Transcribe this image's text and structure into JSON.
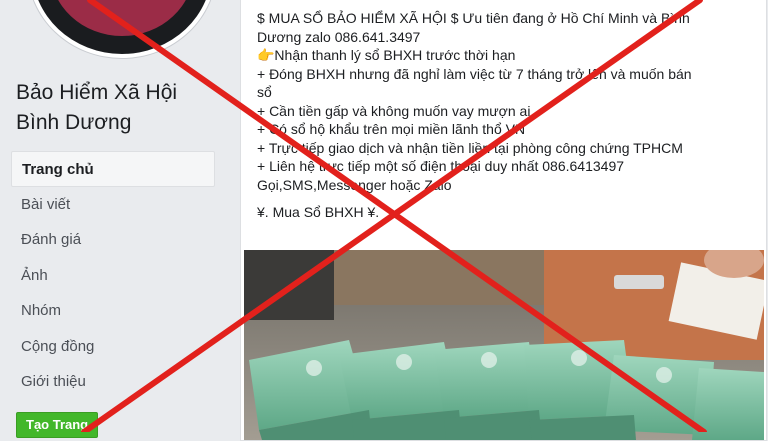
{
  "page": {
    "name_line1": "Bảo Hiểm Xã Hội",
    "name_line2": "Bình Dương"
  },
  "sidebar": {
    "items": [
      {
        "label": "Trang chủ",
        "active": true
      },
      {
        "label": "Bài viết"
      },
      {
        "label": "Đánh giá"
      },
      {
        "label": "Ảnh"
      },
      {
        "label": "Nhóm"
      },
      {
        "label": "Cộng đồng"
      },
      {
        "label": "Giới thiệu"
      }
    ],
    "create_page_label": "Tạo Trang"
  },
  "post": {
    "lines": [
      "$ MUA SỔ BẢO HIỂM XÃ HỘI $ Ưu tiên đang ở Hồ Chí Minh và Bình",
      "Dương zalo 086.641.3497",
      "👉Nhận thanh lý sổ BHXH trước thời hạn",
      "+ Đóng BHXH nhưng đã nghỉ làm việc từ 7 tháng trở lên và muốn bán",
      "sổ",
      "+ Cần tiền gấp và không muốn vay mượn ai",
      "+ Có sổ hộ khẩu trên mọi miền lãnh thổ VN",
      "+ Trực tiếp giao dịch và nhận tiền liền tại phòng công chứng TPHCM",
      "+ Liên hệ trực tiếp một số điện thoại duy nhất 086.6413497",
      "Gọi,SMS,Messenger hoặc Zalo"
    ],
    "footer_line": "¥. Mua Sổ BHXH ¥."
  },
  "colors": {
    "background": "#e9ebee",
    "cross": "#e2211c",
    "create_button": "#42b72a",
    "book_green": "#7fc3a6"
  }
}
